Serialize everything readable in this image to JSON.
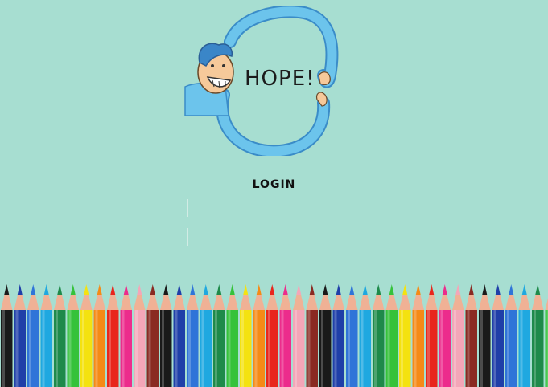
{
  "logo": {
    "text": "HOPE!",
    "icon": "hope-hug-character-icon",
    "colors": {
      "body": "#6cc4ec",
      "outline": "#3a8cc8",
      "hair": "#3a86c8",
      "skin": "#f6c99a"
    }
  },
  "login": {
    "title": "LOGIN",
    "username_value": "",
    "password_value": ""
  },
  "pencils": {
    "icon": "colored-pencils-border",
    "colors": [
      "#1a1a1a",
      "#1f3fa8",
      "#2f74d8",
      "#1fa8e0",
      "#1e8a4a",
      "#35c23a",
      "#f4e210",
      "#f58a16",
      "#e8261c",
      "#ec2c8c",
      "#f4a6b8",
      "#8a2a22"
    ]
  }
}
